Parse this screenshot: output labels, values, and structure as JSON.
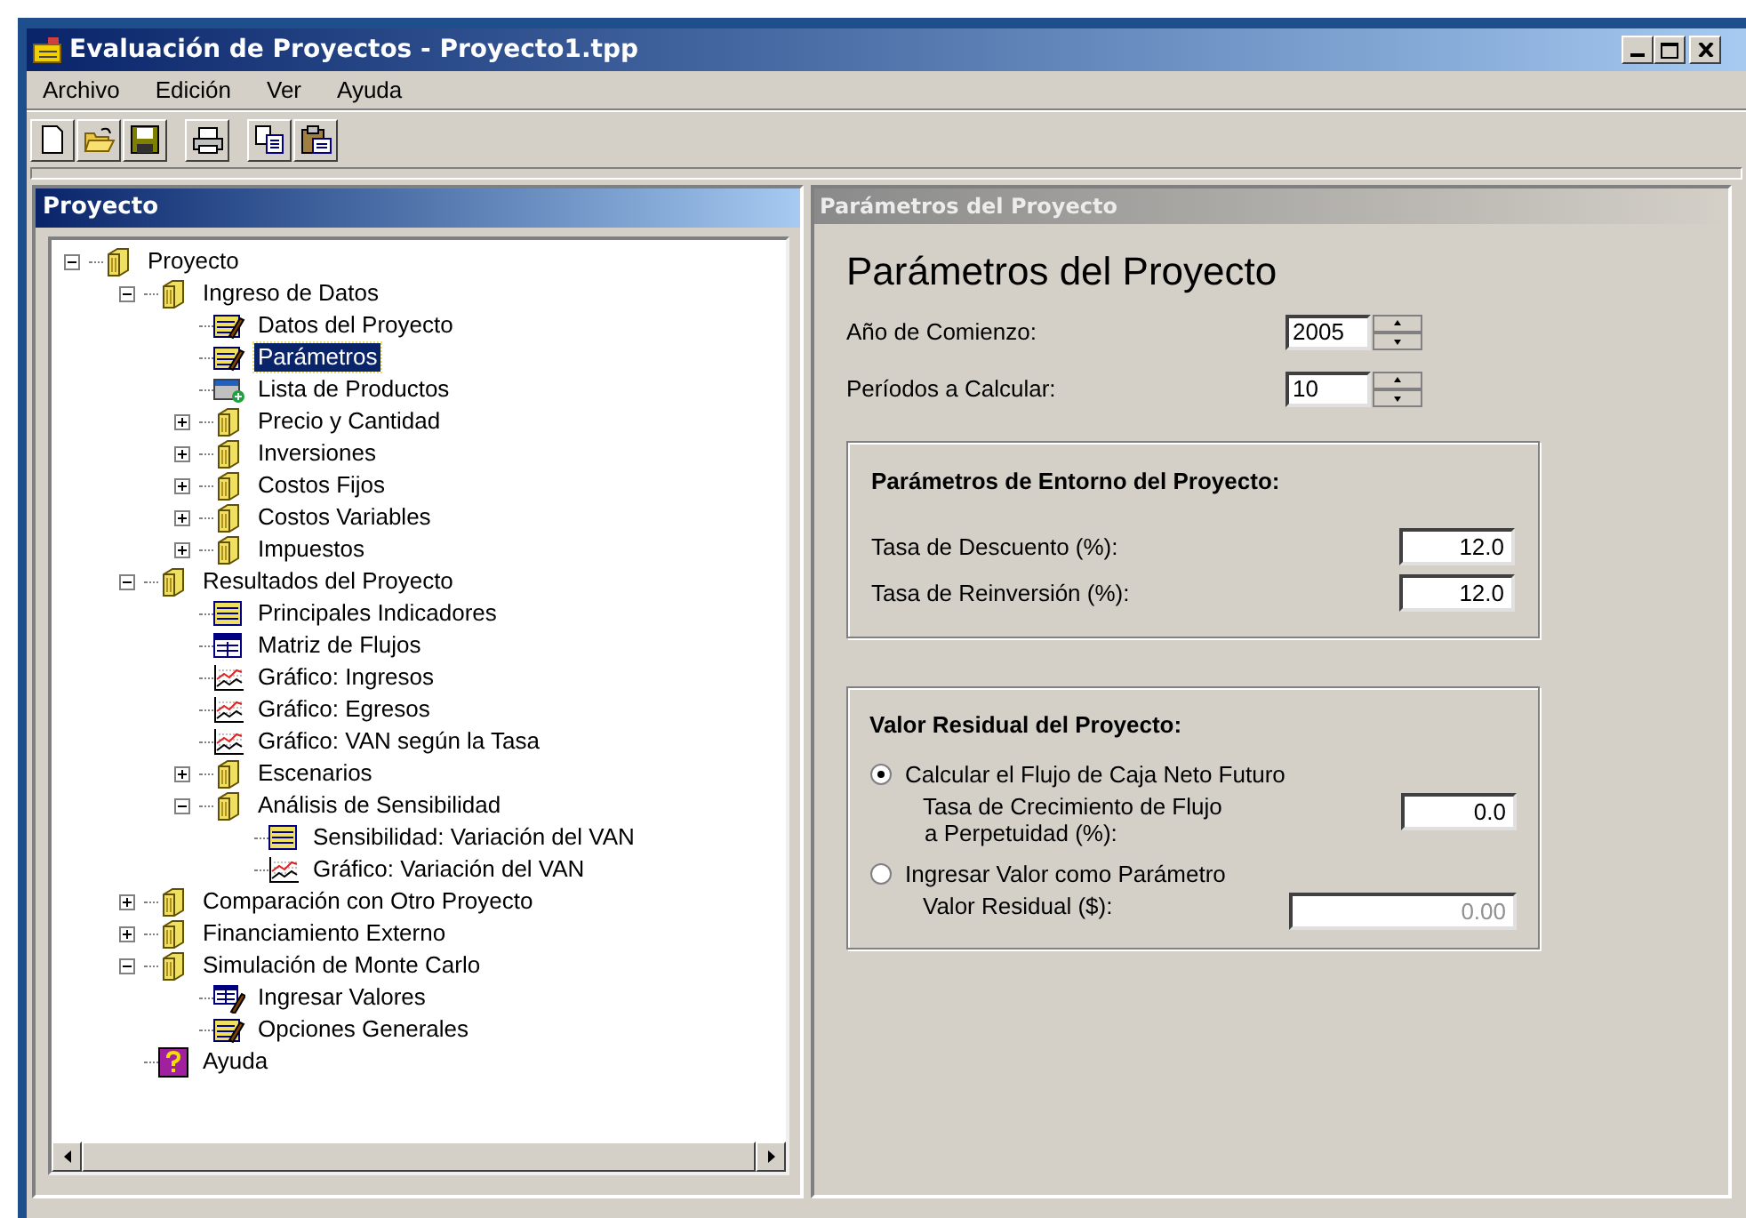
{
  "window": {
    "title": "Evaluación de Proyectos - Proyecto1.tpp"
  },
  "menu": [
    "Archivo",
    "Edición",
    "Ver",
    "Ayuda"
  ],
  "tree_panel": {
    "title": "Proyecto",
    "items": [
      {
        "label": "Proyecto",
        "kind": "folder",
        "expanded": true,
        "selected": false,
        "children": [
          {
            "label": "Ingreso de Datos",
            "kind": "folder",
            "expanded": true,
            "selected": false,
            "children": [
              {
                "label": "Datos del Proyecto",
                "kind": "form",
                "selected": false
              },
              {
                "label": "Parámetros",
                "kind": "form",
                "selected": true
              },
              {
                "label": "Lista de Productos",
                "kind": "list",
                "selected": false
              },
              {
                "label": "Precio y Cantidad",
                "kind": "folder",
                "expanded": false,
                "selected": false
              },
              {
                "label": "Inversiones",
                "kind": "folder",
                "expanded": false,
                "selected": false
              },
              {
                "label": "Costos Fijos",
                "kind": "folder",
                "expanded": false,
                "selected": false
              },
              {
                "label": "Costos Variables",
                "kind": "folder",
                "expanded": false,
                "selected": false
              },
              {
                "label": "Impuestos",
                "kind": "folder",
                "expanded": false,
                "selected": false
              }
            ]
          },
          {
            "label": "Resultados del Proyecto",
            "kind": "folder",
            "expanded": true,
            "selected": false,
            "children": [
              {
                "label": "Principales Indicadores",
                "kind": "report",
                "selected": false
              },
              {
                "label": "Matriz de Flujos",
                "kind": "table",
                "selected": false
              },
              {
                "label": "Gráfico: Ingresos",
                "kind": "chart",
                "selected": false
              },
              {
                "label": "Gráfico: Egresos",
                "kind": "chart",
                "selected": false
              },
              {
                "label": "Gráfico: VAN según la Tasa",
                "kind": "chart",
                "selected": false
              },
              {
                "label": "Escenarios",
                "kind": "folder",
                "expanded": false,
                "selected": false
              },
              {
                "label": "Análisis de Sensibilidad",
                "kind": "folder",
                "expanded": true,
                "selected": false,
                "children": [
                  {
                    "label": "Sensibilidad: Variación del VAN",
                    "kind": "report",
                    "selected": false
                  },
                  {
                    "label": "Gráfico: Variación del VAN",
                    "kind": "chart",
                    "selected": false
                  }
                ]
              }
            ]
          },
          {
            "label": "Comparación con Otro Proyecto",
            "kind": "folder",
            "expanded": false,
            "selected": false
          },
          {
            "label": "Financiamiento Externo",
            "kind": "folder",
            "expanded": false,
            "selected": false
          },
          {
            "label": "Simulación de Monte Carlo",
            "kind": "folder",
            "expanded": true,
            "selected": false,
            "children": [
              {
                "label": "Ingresar Valores",
                "kind": "input",
                "selected": false
              },
              {
                "label": "Opciones Generales",
                "kind": "form",
                "selected": false
              }
            ]
          },
          {
            "label": "Ayuda",
            "kind": "help",
            "selected": false
          }
        ]
      }
    ]
  },
  "params_panel": {
    "header": "Parámetros del Proyecto",
    "title": "Parámetros del Proyecto",
    "spinners": [
      {
        "label": "Año de Comienzo:",
        "value": "2005"
      },
      {
        "label": "Períodos a Calcular:",
        "value": "10"
      }
    ],
    "environment_group": {
      "title": "Parámetros de Entorno del Proyecto:",
      "fields": [
        {
          "label": "Tasa de Descuento (%):",
          "value": "12.0"
        },
        {
          "label": "Tasa de Reinversión (%):",
          "value": "12.0"
        }
      ]
    },
    "residual_group": {
      "title": "Valor Residual del Proyecto:",
      "options": [
        {
          "label": "Calcular el Flujo de Caja Neto Futuro",
          "selected": true,
          "field_label_lines": [
            "Tasa de Crecimiento de Flujo",
            "a Perpetuidad (%):"
          ],
          "value": "0.0",
          "disabled": false
        },
        {
          "label": "Ingresar Valor como Parámetro",
          "selected": false,
          "field_label_lines": [
            "Valor Residual ($):"
          ],
          "value": "0.00",
          "disabled": true
        }
      ]
    }
  }
}
